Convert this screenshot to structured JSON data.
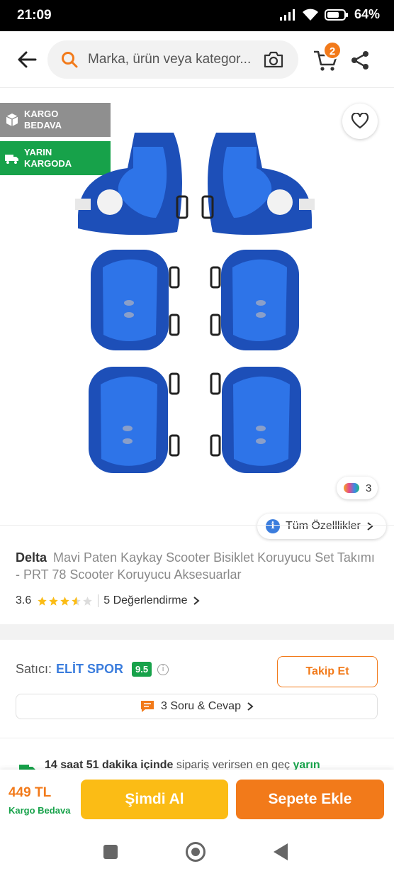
{
  "status_bar": {
    "time": "21:09",
    "battery": "64"
  },
  "header": {
    "search_placeholder": "Marka, ürün veya kategor...",
    "cart_count": "2"
  },
  "gallery": {
    "badge_cargo": "KARGO BEDAVA",
    "badge_fast": "YARIN KARGODA",
    "color_count": "3",
    "features_label": "Tüm Özelllikler"
  },
  "product": {
    "brand": "Delta",
    "title": "Mavi Paten Kaykay Scooter Bisiklet Koruyucu Set Takımı - PRT 78 Scooter Koruyucu Aksesuarlar",
    "rating": "3.6",
    "rating_value": 3.6,
    "reviews": "5 Değerlendirme"
  },
  "seller": {
    "label": "Satıcı:",
    "name": "ELİT SPOR",
    "score": "9.5",
    "follow_label": "Takip Et",
    "qa_label": "3 Soru & Cevap"
  },
  "delivery": {
    "time_text": "14 saat 51 dakika içinde",
    "mid_text": "sipariş verirsen en geç",
    "day_text": "yarın"
  },
  "bottom": {
    "price": "449 TL",
    "free_cargo": "Kargo Bedava",
    "buy_now": "Şimdi Al",
    "add_to_cart": "Sepete Ekle"
  },
  "colors": {
    "accent": "#f27a1a",
    "green": "#17a24a",
    "yellow": "#fbbc15",
    "blue": "#3b7ddd"
  }
}
